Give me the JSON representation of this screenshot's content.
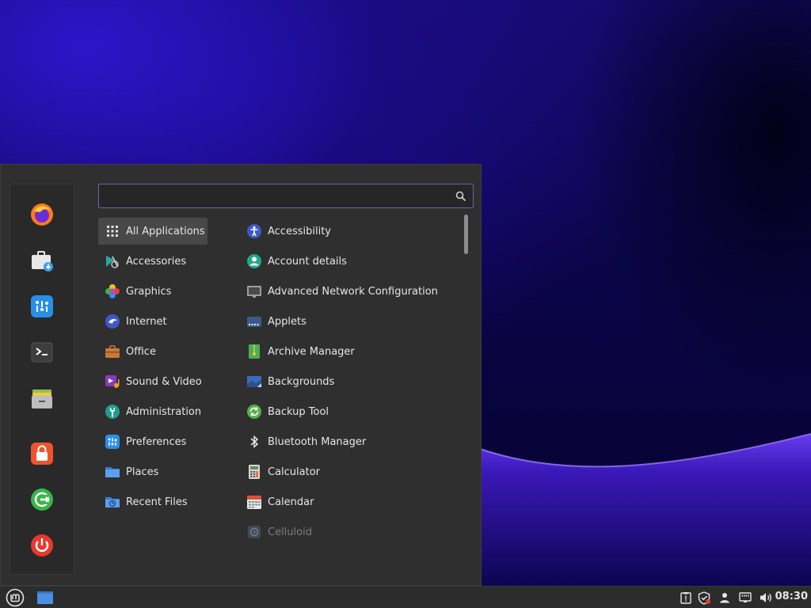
{
  "search": {
    "value": "",
    "placeholder": ""
  },
  "categories": [
    {
      "label": "All Applications",
      "icon": "grid-icon"
    },
    {
      "label": "Accessories",
      "icon": "accessories-icon"
    },
    {
      "label": "Graphics",
      "icon": "graphics-icon"
    },
    {
      "label": "Internet",
      "icon": "internet-icon"
    },
    {
      "label": "Office",
      "icon": "office-icon"
    },
    {
      "label": "Sound & Video",
      "icon": "sound-video-icon"
    },
    {
      "label": "Administration",
      "icon": "administration-icon"
    },
    {
      "label": "Preferences",
      "icon": "preferences-icon"
    },
    {
      "label": "Places",
      "icon": "folder-icon"
    },
    {
      "label": "Recent Files",
      "icon": "recent-files-icon"
    }
  ],
  "apps": [
    {
      "label": "Accessibility",
      "icon": "accessibility-icon"
    },
    {
      "label": "Account details",
      "icon": "account-icon"
    },
    {
      "label": "Advanced Network Configuration",
      "icon": "network-icon"
    },
    {
      "label": "Applets",
      "icon": "applets-icon"
    },
    {
      "label": "Archive Manager",
      "icon": "archive-icon"
    },
    {
      "label": "Backgrounds",
      "icon": "backgrounds-icon"
    },
    {
      "label": "Backup Tool",
      "icon": "backup-icon"
    },
    {
      "label": "Bluetooth Manager",
      "icon": "bluetooth-icon"
    },
    {
      "label": "Calculator",
      "icon": "calculator-icon"
    },
    {
      "label": "Calendar",
      "icon": "calendar-icon"
    },
    {
      "label": "Celluloid",
      "icon": "celluloid-icon"
    }
  ],
  "favorites": [
    "firefox-icon",
    "software-manager-icon",
    "settings-icon",
    "terminal-icon",
    "files-icon",
    "lock-screen-icon",
    "logout-icon",
    "power-icon"
  ],
  "taskbar": {
    "clock": "08:30"
  },
  "colors": {
    "accent": "#6b63b0",
    "menu_bg": "#2f2f2f",
    "taskbar_bg": "#2c2c2c"
  }
}
